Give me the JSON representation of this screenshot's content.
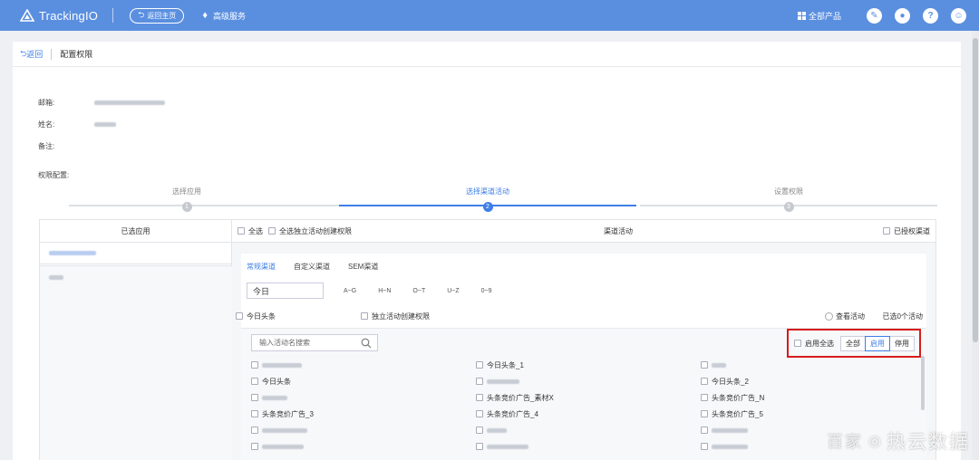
{
  "topbar": {
    "logo": "TrackingIO",
    "home_button": "返回主页",
    "premium": "高级服务",
    "all_products": "全部产品",
    "icons": [
      "wrench-icon",
      "bell-icon",
      "help-icon",
      "user-icon"
    ]
  },
  "breadcrumb": {
    "back": "返回",
    "title": "配置权限"
  },
  "info": {
    "email_label": "邮箱:",
    "name_label": "姓名:",
    "note_label": "备注:",
    "perm_label": "权限配置:"
  },
  "steps": [
    {
      "label": "选择应用",
      "num": "1"
    },
    {
      "label": "选择渠道活动",
      "num": "2"
    },
    {
      "label": "设置权限",
      "num": "3"
    }
  ],
  "panel": {
    "left_header": "已选应用",
    "select_all": "全选",
    "select_all_independent": "全选独立活动创建权限",
    "center_title": "渠道活动",
    "authorized": "已授权渠道",
    "tabs": [
      "常规渠道",
      "自定义渠道",
      "SEM渠道"
    ],
    "channel_input": "今日",
    "letters": [
      "A~G",
      "H~N",
      "O~T",
      "U~Z",
      "0~9"
    ],
    "channel_name": "今日头条",
    "independent_perm": "独立活动创建权限",
    "view_activities": "查看活动",
    "selected_count": "已选0个活动",
    "search_placeholder": "输入活动名搜索",
    "enable_all": "启用全选",
    "filter": [
      "全部",
      "启用",
      "停用"
    ],
    "activities_col1": [
      "",
      "今日头条",
      "",
      "头条竞价广告_3",
      "",
      ""
    ],
    "activities_col2": [
      "今日头条_1",
      "",
      "头条竞价广告_素材X",
      "头条竞价广告_4",
      "",
      ""
    ],
    "activities_col3": [
      "",
      "今日头条_2",
      "头条竞价广告_N",
      "头条竞价广告_5",
      "",
      ""
    ]
  },
  "watermark": {
    "prefix": "百家",
    "text": "热云数据"
  }
}
